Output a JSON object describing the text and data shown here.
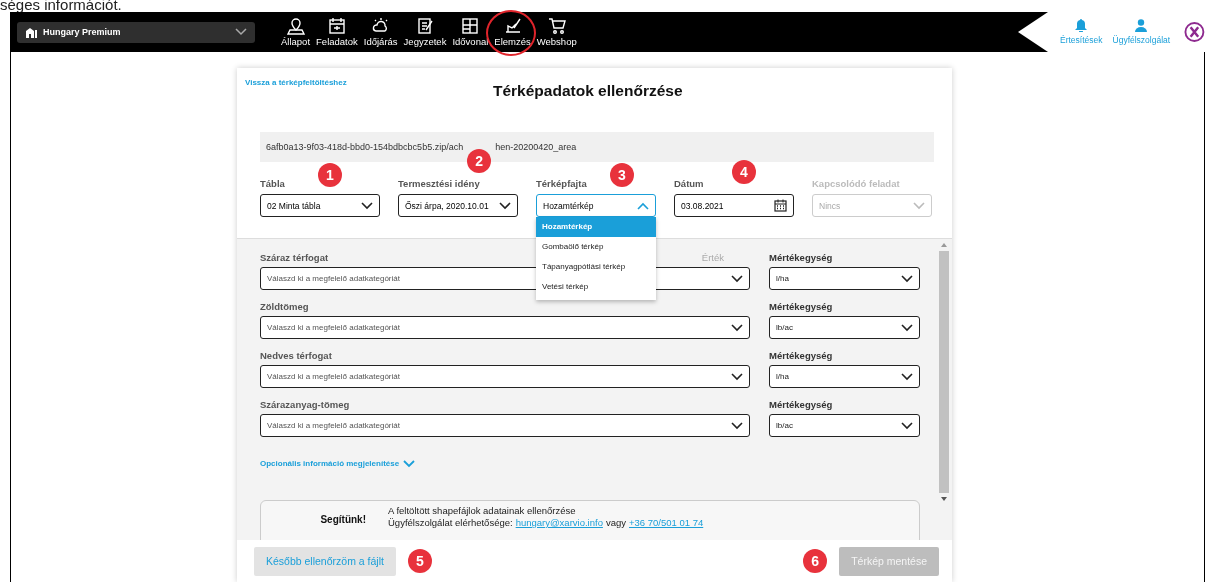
{
  "caption": "séges információt.",
  "nav": {
    "farm": "Hungary Premium",
    "items": [
      {
        "label": "Állapot",
        "selected": false
      },
      {
        "label": "Feladatok",
        "selected": false
      },
      {
        "label": "Időjárás",
        "selected": false
      },
      {
        "label": "Jegyzetek",
        "selected": false
      },
      {
        "label": "Idővonal",
        "selected": false
      },
      {
        "label": "Elemzés",
        "selected": true
      },
      {
        "label": "Webshop",
        "selected": false
      }
    ],
    "right": [
      {
        "label": "Értesítések"
      },
      {
        "label": "Ügyfélszolgálat"
      }
    ]
  },
  "back_link": "Vissza a térképfeltöltéshez",
  "title": "Térképadatok ellenőrzése",
  "file_path_start": "6afb0a13-9f03-418d-bbd0-154bdbcbc5b5.zip/ach",
  "file_path_end": "hen-20200420_area",
  "fields": [
    {
      "label": "Tábla",
      "value": "02 Minta tábla",
      "kind": "select",
      "badge": "1",
      "disabled": false,
      "open": false
    },
    {
      "label": "Termesztési idény",
      "value": "Őszi árpa, 2020.10.01",
      "kind": "select",
      "badge": "2",
      "disabled": false,
      "open": false
    },
    {
      "label": "Térképfajta",
      "value": "Hozamtérkép",
      "kind": "select",
      "badge": "3",
      "disabled": false,
      "open": true,
      "options": [
        {
          "label": "Hozamtérkép",
          "selected": true
        },
        {
          "label": "Gombaölő térkép",
          "selected": false
        },
        {
          "label": "Tápanyagpótlási térkép",
          "selected": false
        },
        {
          "label": "Vetési térkép",
          "selected": false
        }
      ]
    },
    {
      "label": "Dátum",
      "value": "03.08.2021",
      "kind": "date",
      "badge": "4",
      "disabled": false,
      "open": false
    },
    {
      "label": "Kapcsolódó feladat",
      "value": "Nincs",
      "kind": "select",
      "disabled": true,
      "open": false
    }
  ],
  "mappings": [
    {
      "label": "Száraz térfogat",
      "hint": "Érték",
      "placeholder": "Válaszd ki a megfelelő adatkategóriát",
      "unit_label": "Mértékegység",
      "unit": "l/ha"
    },
    {
      "label": "Zöldtömeg",
      "placeholder": "Válaszd ki a megfelelő adatkategóriát",
      "unit_label": "Mértékegység",
      "unit": "lb/ac"
    },
    {
      "label": "Nedves térfogat",
      "placeholder": "Válaszd ki a megfelelő adatkategóriát",
      "unit_label": "Mértékegység",
      "unit": "l/ha"
    },
    {
      "label": "Szárazanyag-tömeg",
      "placeholder": "Válaszd ki a megfelelő adatkategóriát",
      "unit_label": "Mértékegység",
      "unit": "lb/ac"
    }
  ],
  "optional_link": "Opcionális információ megjelenítése",
  "help": {
    "title": "Segítünk!",
    "line1": "A feltöltött shapefájlok adatainak ellenőrzése",
    "line2_prefix": "Ügyfélszolgálat elérhetősége:",
    "email": "hungary@xarvio.info",
    "line2_mid": "vagy",
    "phone": "+36 70/501 01 74"
  },
  "buttons": [
    {
      "label": "Később ellenőrzöm a fájlt",
      "badge": "5",
      "disabled": false
    },
    {
      "label": "Térkép mentése",
      "badge": "6",
      "disabled": true
    }
  ]
}
